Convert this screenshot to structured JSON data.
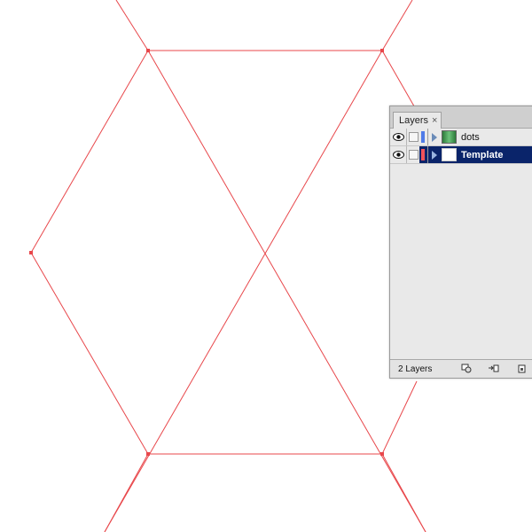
{
  "artboard": {
    "guide_color": "#e8474b",
    "background": "#ffffff"
  },
  "layers_panel": {
    "tab_label": "Layers",
    "close_glyph": "×",
    "layers": [
      {
        "name": "dots",
        "color": "#4f7be8",
        "thumbnail": "dots",
        "selected": false,
        "visible": true
      },
      {
        "name": "Template",
        "color": "#f0525a",
        "thumbnail": "blank",
        "selected": true,
        "visible": true
      }
    ],
    "footer": {
      "count_label": "2 Layers",
      "buttons": [
        "make-clipping-mask-icon",
        "new-sublayer-icon",
        "new-layer-icon"
      ]
    }
  }
}
